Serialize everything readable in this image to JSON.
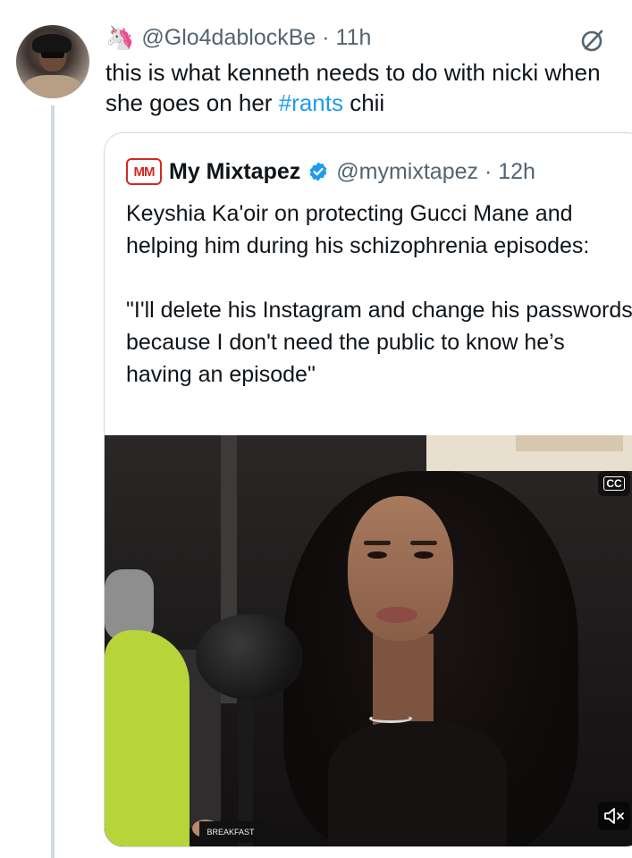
{
  "tweet": {
    "emoji": "🦄",
    "handle": "@Glo4dablockBe",
    "separator": "·",
    "time": "11h",
    "text_before": "this is what kenneth needs to do with nicki when she goes on her ",
    "hashtag": "#rants",
    "text_after": " chii"
  },
  "quote": {
    "logo_text": "MM",
    "name": "My Mixtapez",
    "handle": "@mymixtapez",
    "separator": "·",
    "time": "12h",
    "paragraph1": "Keyshia Ka'oir on protecting Gucci Mane and helping him during his schizophrenia episodes:",
    "paragraph2": "\"I'll delete his Instagram and change his passwords because I don't need the public to know he’s having an episode\"",
    "media": {
      "cc_label": "CC",
      "mic_label": "BREAKFAST"
    }
  },
  "colors": {
    "link": "#1d9bf0",
    "secondary_text": "#536471",
    "verified": "#1d9bf0",
    "border": "#cfd9de"
  },
  "icons": [
    "unicorn-emoji",
    "grok-icon",
    "verified-badge-icon",
    "closed-captions-icon",
    "mute-icon"
  ]
}
